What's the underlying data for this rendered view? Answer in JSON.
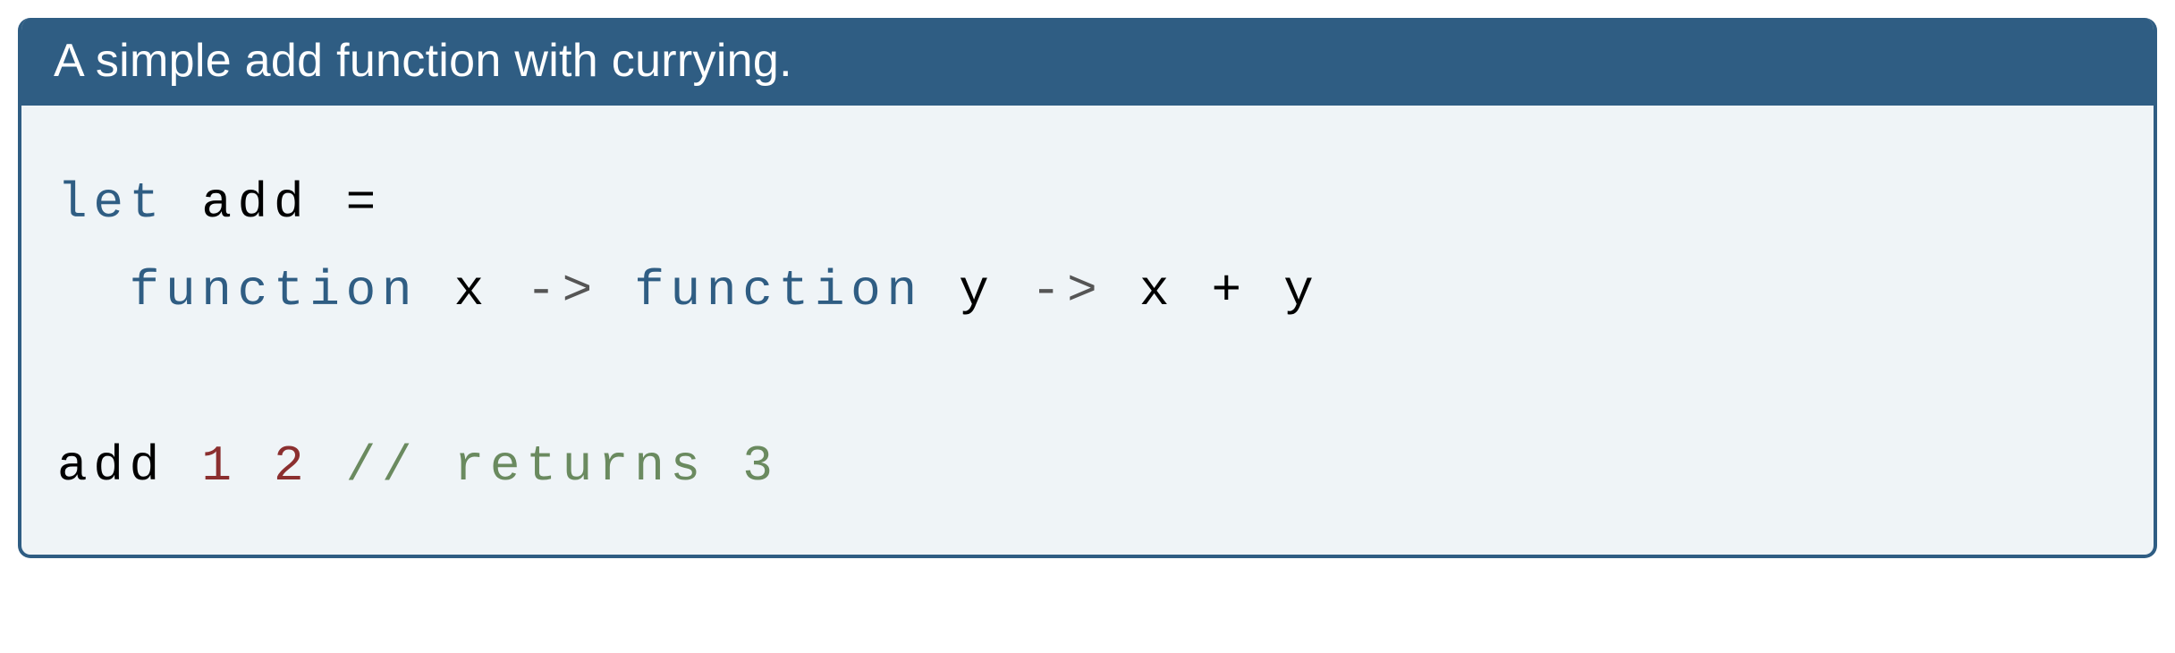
{
  "header": {
    "title": "A simple add function with currying."
  },
  "code": {
    "line1": {
      "let": "let",
      "name": "add",
      "eq": "="
    },
    "line2": {
      "fn1": "function",
      "x": "x",
      "arrow1": "->",
      "fn2": "function",
      "y": "y",
      "arrow2": "->",
      "expr_x": "x",
      "plus": "+",
      "expr_y": "y"
    },
    "line4": {
      "call": "add",
      "n1": "1",
      "n2": "2",
      "slashes": "//",
      "comment": "returns 3"
    }
  }
}
